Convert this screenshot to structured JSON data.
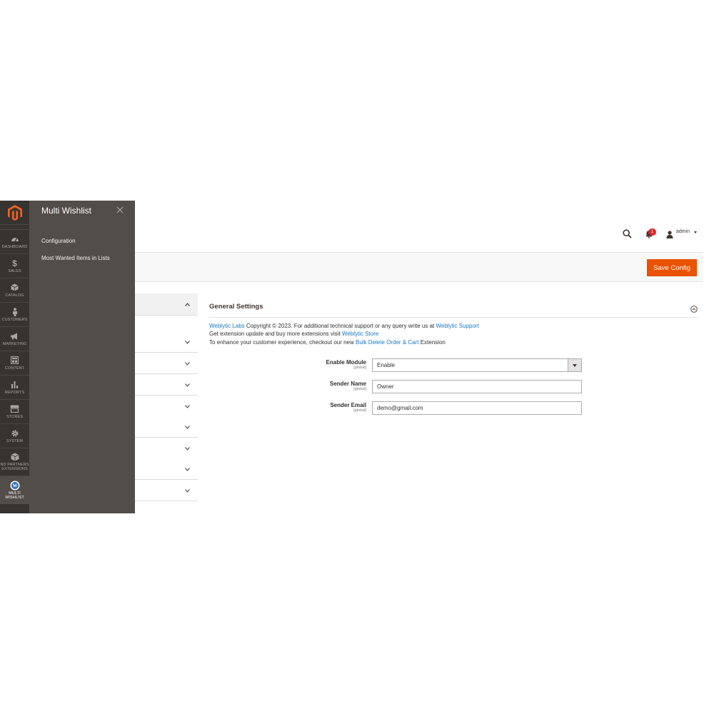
{
  "sidebar": {
    "items": [
      {
        "label": "DASHBOARD",
        "icon": "dashboard-icon"
      },
      {
        "label": "SALES",
        "icon": "dollar-icon"
      },
      {
        "label": "CATALOG",
        "icon": "cube-icon"
      },
      {
        "label": "CUSTOMERS",
        "icon": "person-icon"
      },
      {
        "label": "MARKETING",
        "icon": "megaphone-icon"
      },
      {
        "label": "CONTENT",
        "icon": "layout-icon"
      },
      {
        "label": "REPORTS",
        "icon": "bar-chart-icon"
      },
      {
        "label": "STORES",
        "icon": "storefront-icon"
      },
      {
        "label": "SYSTEM",
        "icon": "gear-icon"
      },
      {
        "label": "ND PARTNERS EXTENSIONS",
        "icon": "box-icon"
      },
      {
        "label": "MULTI WISHLIST",
        "icon": "weblytic-w-icon"
      }
    ]
  },
  "flyout": {
    "title": "Multi Wishlist",
    "links": [
      "Configuration",
      "Most Wanted Items in Lists"
    ]
  },
  "header": {
    "notification_count": "1",
    "user_name": "admin"
  },
  "actions": {
    "save_label": "Save Config"
  },
  "section": {
    "title": "General Settings",
    "info": {
      "line1_link": "Weblytic Labs",
      "line1_text": " Copyright © 2023. For additional technical support or any query write us at ",
      "line1_link2": "Weblytic Support",
      "line2_text": "Get extension update and buy more extensions visit ",
      "line2_link": "Weblytic Store",
      "line3_text": "To enhance your customer experience, checkout our new ",
      "line3_link": "Bulk Delete Order & Cart",
      "line3_tail": " Extension"
    },
    "fields": [
      {
        "label": "Enable Module",
        "scope": "[global]",
        "value": "Enable"
      },
      {
        "label": "Sender Name",
        "scope": "[global]",
        "value": "Owner"
      },
      {
        "label": "Sender Email",
        "scope": "[global]",
        "value": "demo@gmail.com"
      }
    ]
  },
  "colors": {
    "sidebar_bg": "#373330",
    "flyout_bg": "#524d49",
    "save_button": "#eb5202",
    "link": "#1979c3"
  }
}
